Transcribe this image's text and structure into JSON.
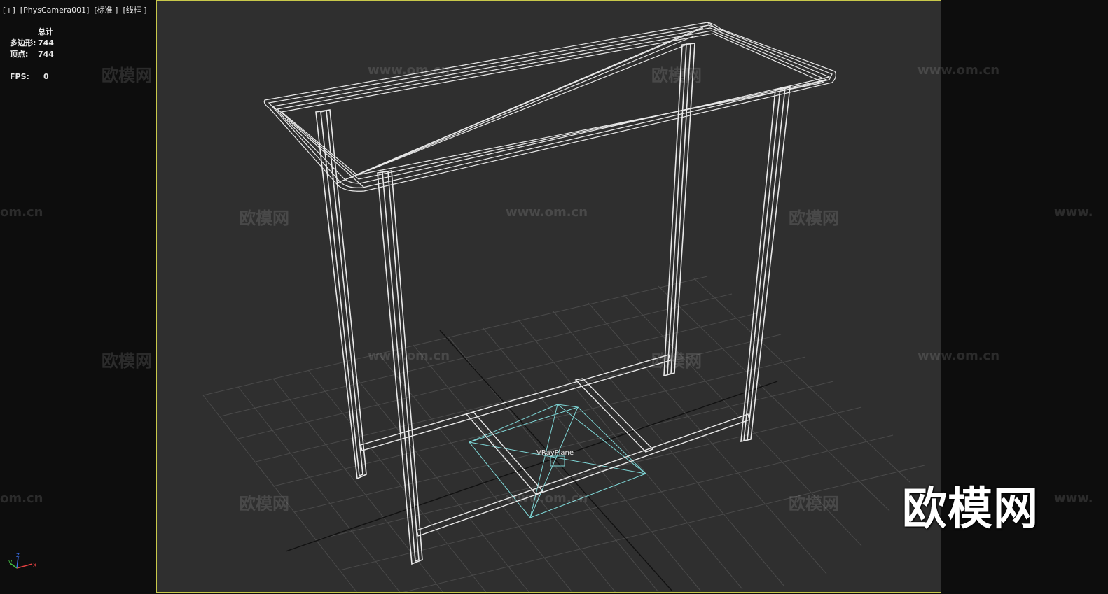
{
  "viewport": {
    "label": "[+]  [PhysCamera001]  [标准 ]  [线框 ]"
  },
  "stats": {
    "header": "总计",
    "polygons_label": "多边形:",
    "polygons_value": "744",
    "vertices_label": "顶点:",
    "vertices_value": "744",
    "fps_label": "FPS:",
    "fps_value": "0"
  },
  "scene": {
    "object_label": "VRayPlane",
    "axis_x": "x",
    "axis_y": "y",
    "axis_z": "z"
  },
  "watermark": {
    "cn": "欧模网",
    "url": "www.om.cn",
    "url_short": "om.cn",
    "url_partial": "www."
  },
  "brand": "欧模网",
  "colors": {
    "viewport_bg": "#2f2f2f",
    "frame_border": "#c8c84a",
    "wire": "#e8e8e8",
    "grid": "#4a4a4a",
    "camera_wire": "#7fd7d7"
  }
}
